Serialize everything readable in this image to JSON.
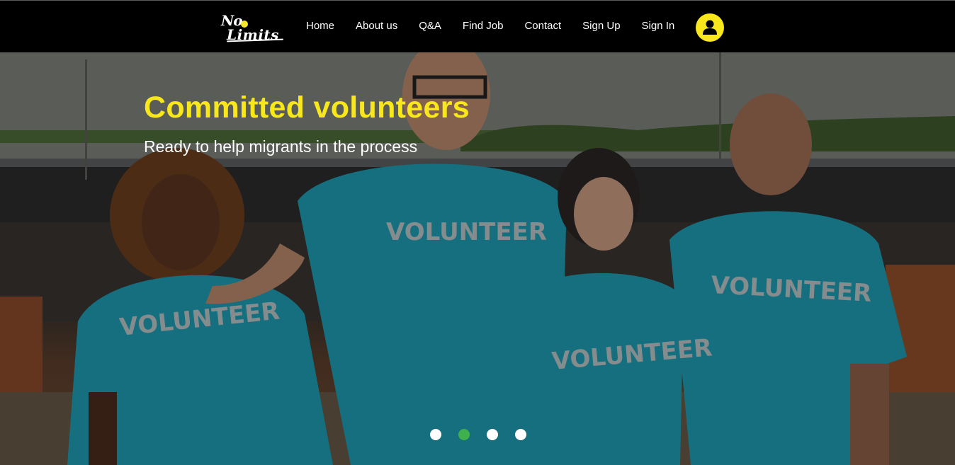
{
  "logo": {
    "line1": "No",
    "line2": "Limits"
  },
  "nav": {
    "items": [
      "Home",
      "About us",
      "Q&A",
      "Find Job",
      "Contact",
      "Sign Up",
      "Sign In"
    ]
  },
  "user": {
    "icon": "user-icon",
    "color": "#f8e71c"
  },
  "hero": {
    "title": "Committed volunteers",
    "subtitle": "Ready to help migrants in the process",
    "shirt_text": "VOLUNTEER",
    "slides_total": 4,
    "active_slide": 2,
    "title_color": "#f8e71c",
    "active_dot_color": "#3fb04c"
  }
}
